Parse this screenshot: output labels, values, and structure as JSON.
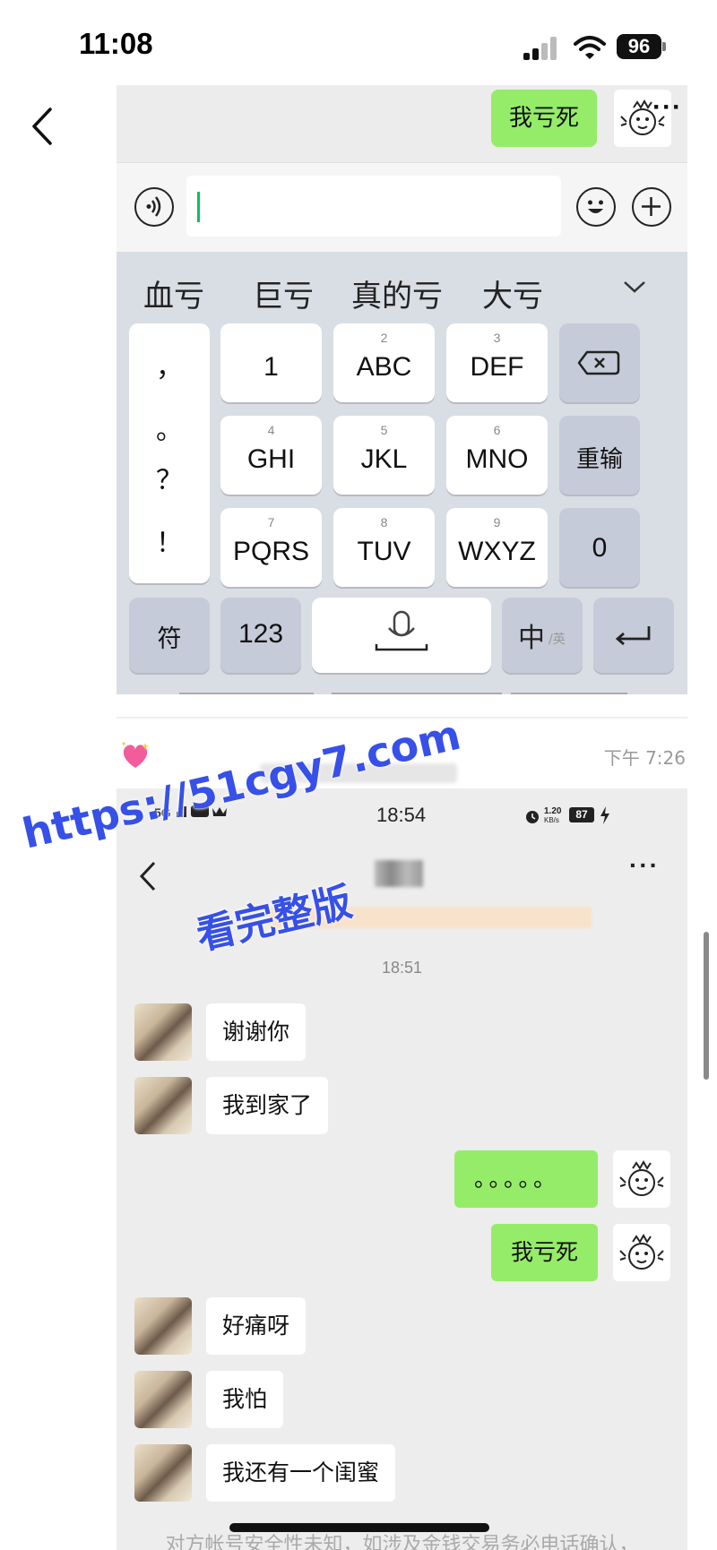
{
  "status_bar": {
    "time": "11:08",
    "battery": "96"
  },
  "keyboard_shot": {
    "top_message": "我亏死",
    "candidates": [
      "血亏",
      "巨亏",
      "真的亏",
      "大亏"
    ],
    "punctuation": [
      "，",
      "。",
      "？",
      "！"
    ],
    "keys_row1": [
      {
        "sub": "",
        "main": "1"
      },
      {
        "sub": "2",
        "main": "ABC"
      },
      {
        "sub": "3",
        "main": "DEF"
      }
    ],
    "keys_row2": [
      {
        "sub": "4",
        "main": "GHI"
      },
      {
        "sub": "5",
        "main": "JKL"
      },
      {
        "sub": "6",
        "main": "MNO"
      }
    ],
    "keys_row3": [
      {
        "sub": "7",
        "main": "PQRS"
      },
      {
        "sub": "8",
        "main": "TUV"
      },
      {
        "sub": "9",
        "main": "WXYZ"
      }
    ],
    "reinput_label": "重输",
    "zero_label": "0",
    "symbols_label": "符",
    "numbers_label": "123",
    "lang_main": "中",
    "lang_sub": "/英"
  },
  "feed": {
    "time": "下午 7:26"
  },
  "chat_shot": {
    "status_time": "18:54",
    "status_net": "5G",
    "status_speed": "1.20",
    "status_speed_unit": "KB/s",
    "status_battery": "87",
    "timestamp": "18:51",
    "messages": [
      {
        "side": "in",
        "text": "谢谢你"
      },
      {
        "side": "in",
        "text": "我到家了"
      },
      {
        "side": "out",
        "text": "。。。。。"
      },
      {
        "side": "out",
        "text": "我亏死"
      },
      {
        "side": "in",
        "text": "好痛呀"
      },
      {
        "side": "in",
        "text": "我怕"
      },
      {
        "side": "in",
        "text": "我还有一个闺蜜"
      }
    ],
    "bottom_note": "对方帐号安全性未知，如涉及金钱交易务必电话确认，"
  },
  "watermark": {
    "line1": "https://51cgy7.com",
    "line2": "看完整版"
  },
  "colors": {
    "bubble_out": "#95ec69",
    "bubble_in": "#ffffff",
    "watermark": "#3650e8",
    "caret": "#07c160"
  }
}
